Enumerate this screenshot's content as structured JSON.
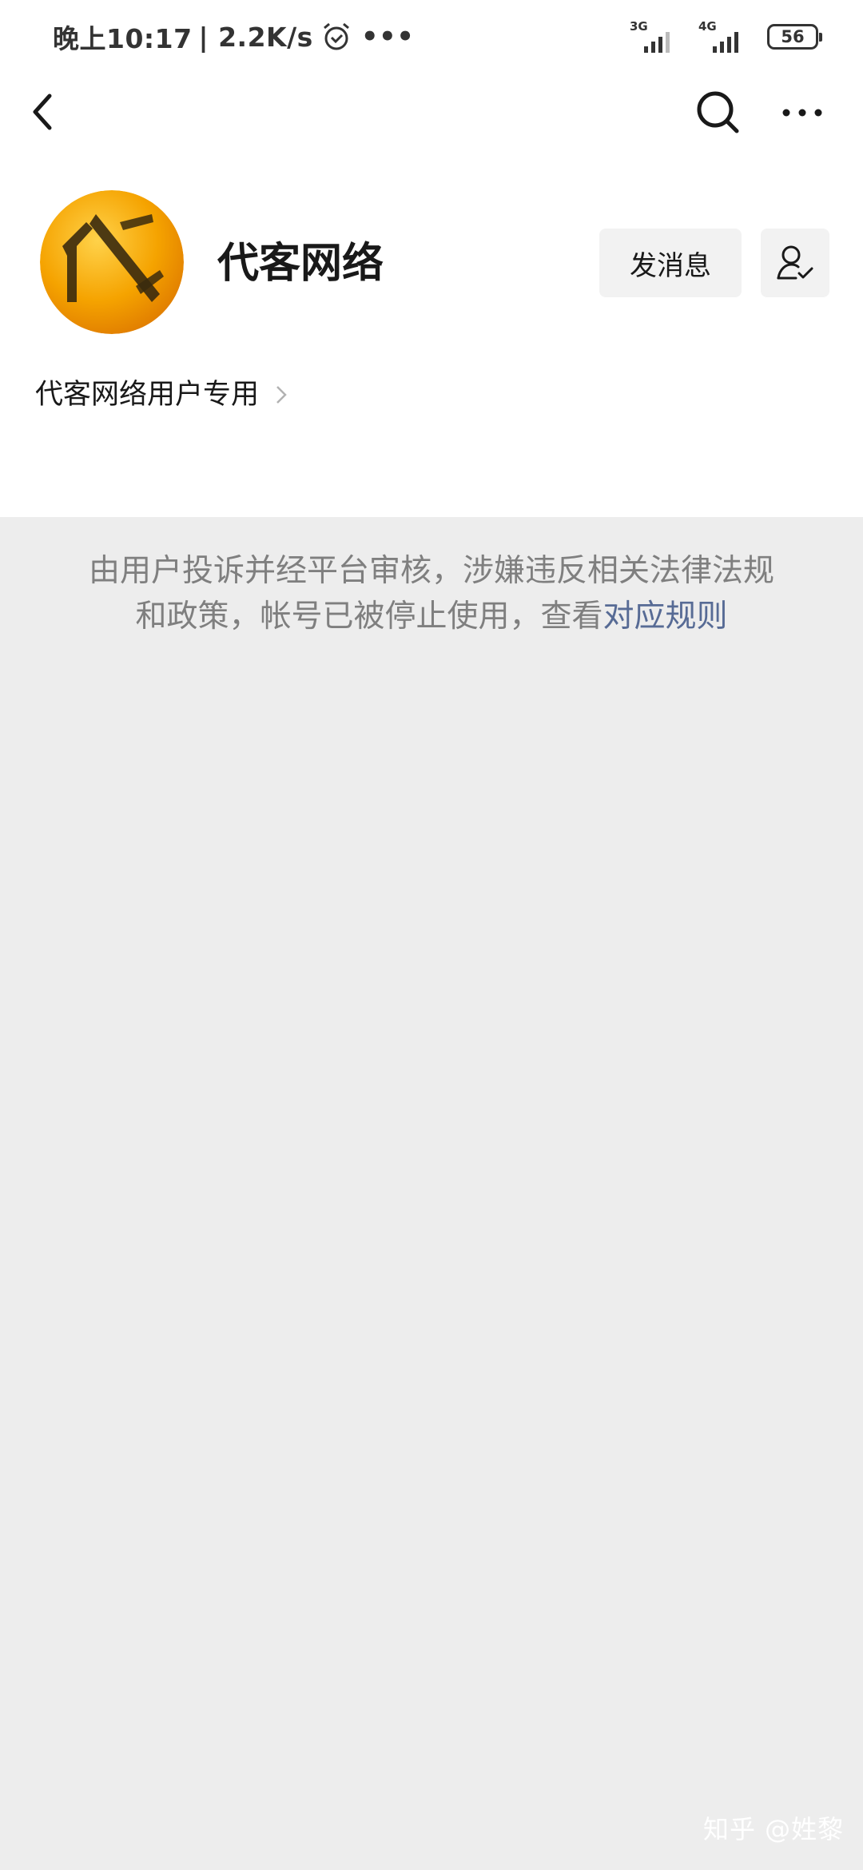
{
  "status_bar": {
    "time": "晚上10:17",
    "speed": "| 2.2K/s",
    "more_dots": "•••",
    "signal1_label": "3G",
    "signal2_label": "4G",
    "battery": "56"
  },
  "nav": {
    "back_icon": "chevron-left-icon",
    "search_icon": "search-icon",
    "more_icon": "more-horizontal-icon"
  },
  "profile": {
    "name": "代客网络",
    "send_message_label": "发消息",
    "user_icon": "user-check-icon",
    "description": "代客网络用户专用"
  },
  "notice": {
    "text": "由用户投诉并经平台审核，涉嫌违反相关法律法规和政策，帐号已被停止使用，查看",
    "link_text": "对应规则"
  },
  "watermark": "知乎 @姓黎",
  "colors": {
    "page_bg": "#ededed",
    "card_bg": "#ffffff",
    "link": "#576b95",
    "notice_text": "#7f7f7f",
    "button_bg": "#f2f2f2"
  }
}
